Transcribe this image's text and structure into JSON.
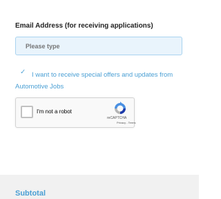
{
  "email": {
    "label": "Email Address (for receiving applications)",
    "placeholder": "Please type"
  },
  "optin": {
    "checkmark": "✓",
    "text": "I want to receive special offers and updates from Automotive Jobs",
    "checked": true
  },
  "recaptcha": {
    "label": "I'm not a robot",
    "brand": "reCAPTCHA",
    "links": "Privacy - Terms",
    "checked": false,
    "logo_icon": "recaptcha-logo-icon"
  },
  "summary": {
    "subtotal_label": "Subtotal"
  },
  "colors": {
    "accent": "#4a9fd4",
    "input_bg": "#e9f4fc",
    "input_border": "#a9d3ef",
    "section_bg": "#f1f1f1"
  }
}
